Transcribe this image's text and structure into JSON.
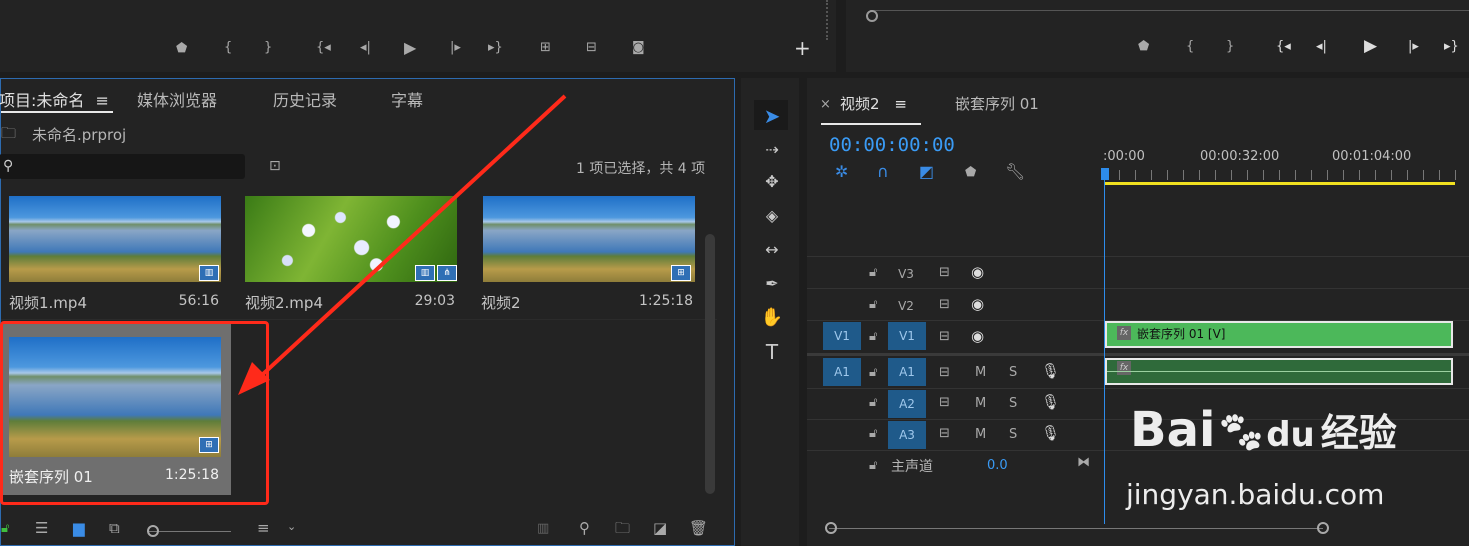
{
  "program_monitor_controls": {
    "icons": [
      "marker-icon",
      "in-point-icon",
      "out-point-icon",
      "go-to-in-icon",
      "step-back-icon",
      "play-icon",
      "step-forward-icon",
      "go-to-out-icon",
      "lift-icon",
      "extract-icon",
      "export-frame-icon",
      "add-button-icon"
    ]
  },
  "project_panel": {
    "tabs": [
      "项目:未命名",
      "媒体浏览器",
      "历史记录",
      "字幕"
    ],
    "project_file": "未命名.prproj",
    "search_placeholder": "",
    "selection_status": "1 项已选择，共 4 项",
    "items": [
      {
        "name": "视频1.mp4",
        "duration": "56:16",
        "thumb": "lake"
      },
      {
        "name": "视频2.mp4",
        "duration": "29:03",
        "thumb": "flower"
      },
      {
        "name": "视频2",
        "duration": "1:25:18",
        "thumb": "lake"
      },
      {
        "name": "嵌套序列 01",
        "duration": "1:25:18",
        "thumb": "lake"
      }
    ]
  },
  "timeline": {
    "tabs": [
      "视频2",
      "嵌套序列 01"
    ],
    "timecode": "00:00:00:00",
    "ruler": [
      ":00:00",
      "00:00:32:00",
      "00:01:04:00"
    ],
    "video_tracks": [
      "V3",
      "V2",
      "V1"
    ],
    "audio_tracks": [
      "A1",
      "A2",
      "A3"
    ],
    "source_v": "V1",
    "source_a": "A1",
    "mute_label": "M",
    "solo_label": "S",
    "master_label": "主声道",
    "master_value": "0.0",
    "clip_v_label": "嵌套序列 01 [V]",
    "fx_label": "fx"
  },
  "watermark": {
    "brand": "Bai",
    "brand2": "du",
    "suffix": "经验",
    "url": "jingyan.baidu.com"
  },
  "colors": {
    "accent_blue": "#2d8ceb",
    "selection_red": "#ff2a1a",
    "clip_green": "#4cb85a",
    "timecode_blue": "#3a9bf5",
    "work_area_yellow": "#f0e020"
  }
}
